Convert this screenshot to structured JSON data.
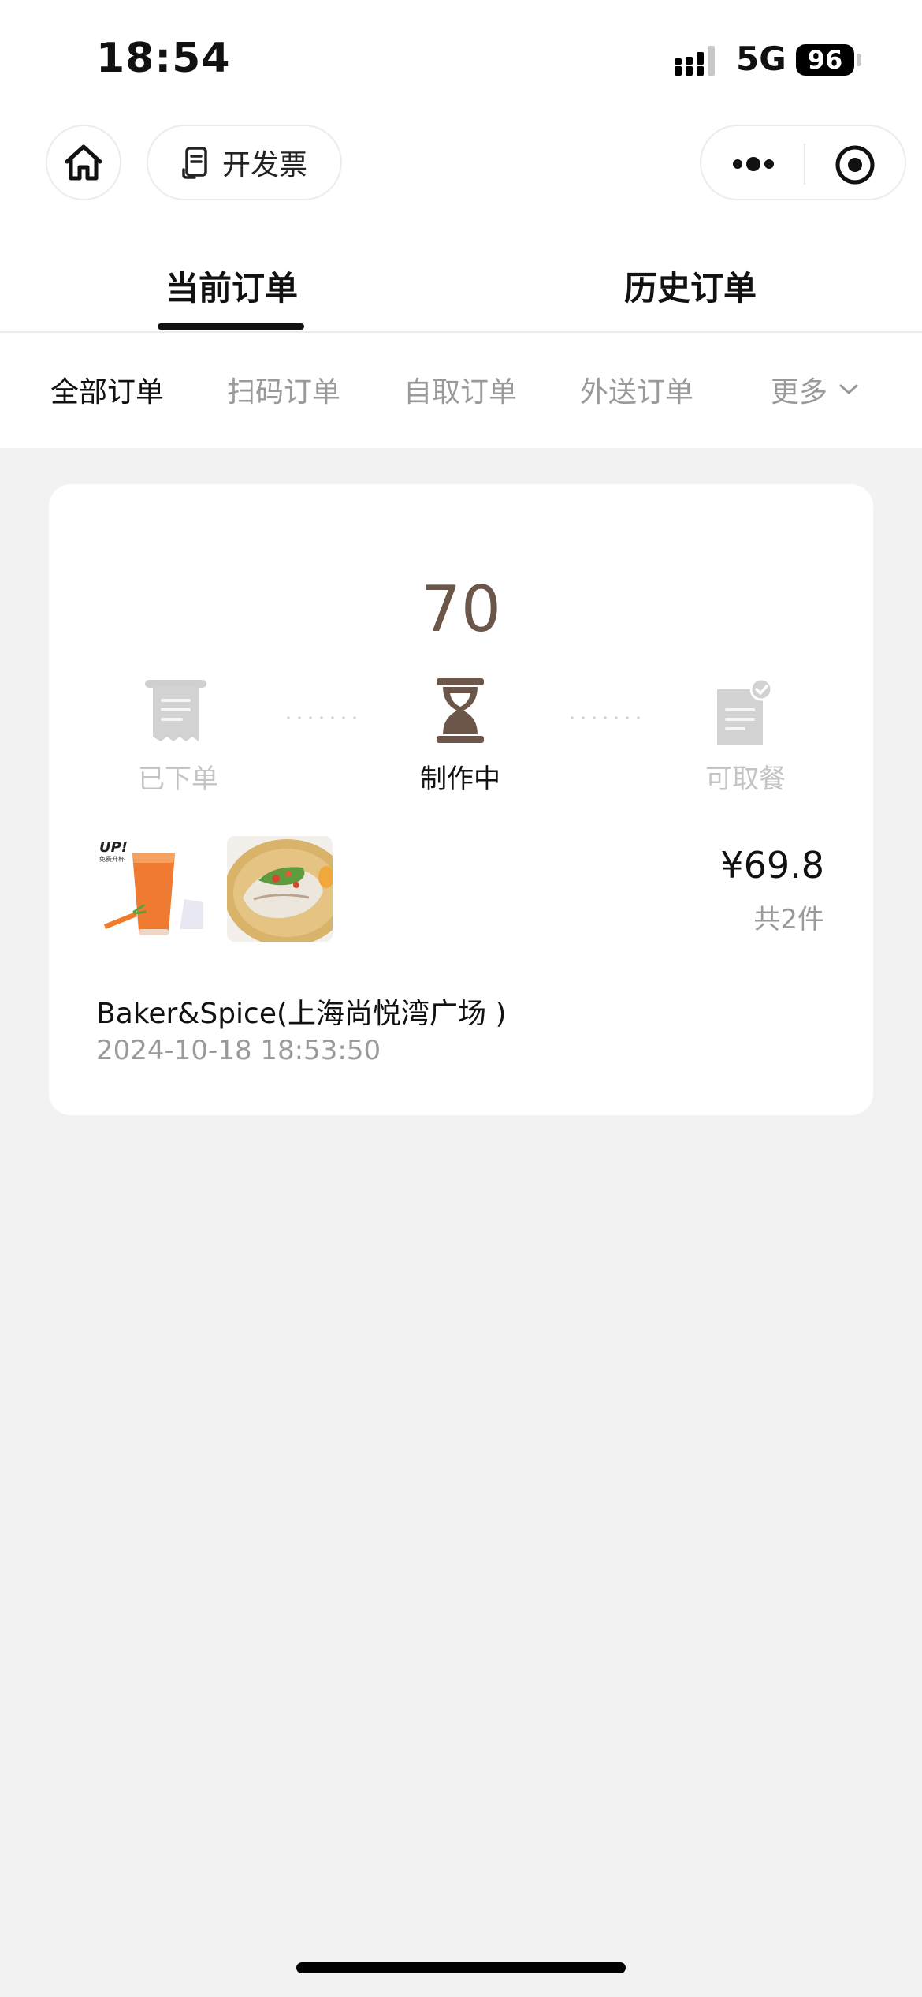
{
  "status_bar": {
    "time": "18:54",
    "network": "5G",
    "battery": "96"
  },
  "header": {
    "home_icon": "home-icon",
    "invoice_label": "开发票",
    "invoice_icon": "receipt-icon",
    "more_icon": "more-dots-icon",
    "close_icon": "target-icon"
  },
  "main_tabs": [
    {
      "label": "当前订单",
      "active": true
    },
    {
      "label": "历史订单",
      "active": false
    }
  ],
  "filters": [
    {
      "label": "全部订单",
      "active": true
    },
    {
      "label": "扫码订单",
      "active": false
    },
    {
      "label": "自取订单",
      "active": false
    },
    {
      "label": "外送订单",
      "active": false
    },
    {
      "label": "更多",
      "active": false
    }
  ],
  "order": {
    "pickup_number": "70",
    "steps": [
      {
        "label": "已下单",
        "icon": "receipt-icon",
        "state": "done"
      },
      {
        "label": "制作中",
        "icon": "hourglass-icon",
        "state": "current"
      },
      {
        "label": "可取餐",
        "icon": "document-check-icon",
        "state": "pending"
      }
    ],
    "thumb1_badge": "UP!",
    "thumb1_badge_sub": "免费升杯",
    "price": "¥69.8",
    "count": "共2件",
    "store": "Baker&Spice(上海尚悦湾广场 )",
    "time": "2024-10-18 18:53:50"
  },
  "colors": {
    "accent": "#6b5649",
    "muted": "#9a9a9a",
    "background": "#f2f2f2"
  }
}
